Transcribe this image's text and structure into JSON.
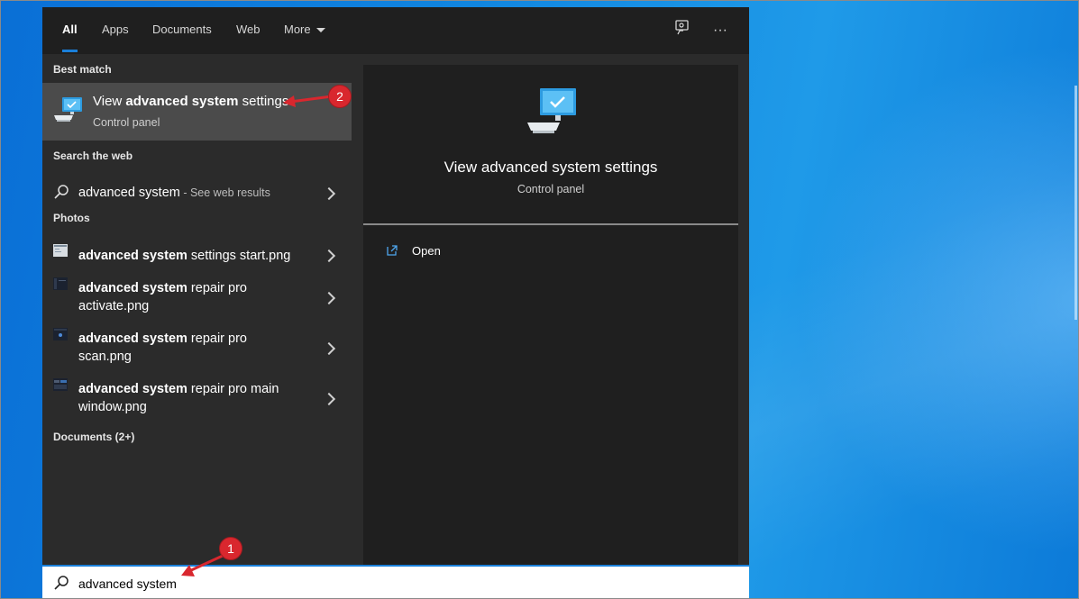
{
  "tabs": [
    {
      "label": "All",
      "active": true
    },
    {
      "label": "Apps"
    },
    {
      "label": "Documents"
    },
    {
      "label": "Web"
    },
    {
      "label": "More"
    }
  ],
  "topbar_icons": [
    "feedback-icon",
    "more-options-icon"
  ],
  "sections": {
    "best_match": "Best match",
    "search_web": "Search the web",
    "photos": "Photos",
    "documents": "Documents (2+)"
  },
  "best_match": {
    "title_pre": "View ",
    "title_bold": "advanced system",
    "title_post": " settings",
    "subtitle": "Control panel"
  },
  "web_result": {
    "query": "advanced system",
    "suffix": " - See web results"
  },
  "photos": [
    {
      "bold": "advanced system",
      "rest_line1": " settings start.png",
      "line2": ""
    },
    {
      "bold": "advanced system",
      "rest_line1": " repair pro",
      "line2": "activate.png"
    },
    {
      "bold": "advanced system",
      "rest_line1": " repair pro",
      "line2": "scan.png"
    },
    {
      "bold": "advanced system",
      "rest_line1": " repair pro main",
      "line2": "window.png"
    }
  ],
  "preview": {
    "title": "View advanced system settings",
    "subtitle": "Control panel",
    "action": "Open"
  },
  "search": {
    "value": "advanced system"
  },
  "annotations": {
    "badge1": "1",
    "badge2": "2"
  },
  "colors": {
    "accent": "#1a7fd9",
    "annotation": "#d9272e",
    "panel": "#2b2b2b",
    "preview_panel": "#1f1f1f"
  }
}
